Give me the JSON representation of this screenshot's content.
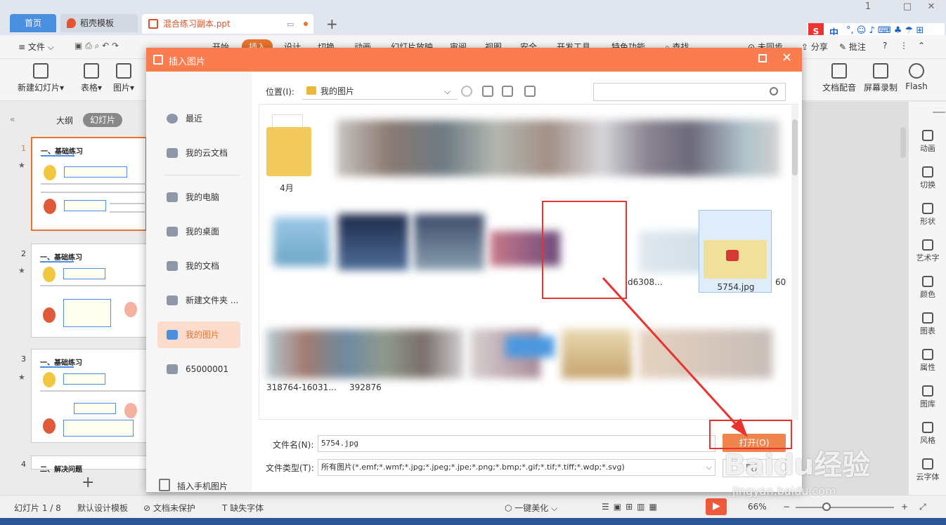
{
  "tabs": {
    "home": "首页",
    "template": "稻壳模板",
    "doc": "混合练习副本.ppt"
  },
  "menu": [
    "文件",
    "开始",
    "插入",
    "设计",
    "切换",
    "动画",
    "幻灯片放映",
    "审阅",
    "视图",
    "安全",
    "开发工具",
    "特色功能",
    "查找"
  ],
  "menu_right": {
    "share": "分享",
    "comment": "批注",
    "sync": "未同步"
  },
  "ribbon": [
    "新建幻灯片",
    "表格",
    "图片"
  ],
  "ribbon_right": [
    "文档配音",
    "屏幕录制",
    "Flash"
  ],
  "sogou": {
    "lang": "中"
  },
  "left_panel": {
    "outline": "大纲",
    "slides": "幻灯片",
    "thumbs": [
      {
        "num": "1",
        "title": "一、基础练习"
      },
      {
        "num": "2",
        "title": "一、基础练习"
      },
      {
        "num": "3",
        "title": "一、基础练习"
      },
      {
        "num": "4",
        "title": "二、解决问题"
      }
    ]
  },
  "right_panel": [
    "动画",
    "切换",
    "形状",
    "艺术字",
    "颜色",
    "图表",
    "属性",
    "图库",
    "风格",
    "云字体"
  ],
  "status": {
    "slide": "幻灯片 1 / 8",
    "design": "默认设计模板",
    "protect": "文档未保护",
    "font": "缺失字体",
    "beautify": "一键美化",
    "zoom": "66%"
  },
  "dialog": {
    "title": "插入图片",
    "nav": [
      "最近",
      "我的云文档",
      "我的电脑",
      "我的桌面",
      "我的文档",
      "新建文件夹 ...",
      "我的图片",
      "65000001"
    ],
    "mobile": "插入手机图片",
    "location_label": "位置(I):",
    "location": "我的图片",
    "files": {
      "folder": "4月",
      "selected": "5754.jpg",
      "partial": [
        "318764-16031...",
        "392876",
        "d6308...",
        "60"
      ]
    },
    "filename_label": "文件名(N):",
    "filename": "5754.jpg",
    "filetype_label": "文件类型(T):",
    "filetype": "所有图片(*.emf;*.wmf;*.jpg;*.jpeg;*.jpe;*.png;*.bmp;*.gif;*.tif;*.tiff;*.wdp;*.svg)",
    "open": "打开(O)",
    "cancel": "取消"
  },
  "watermark": {
    "logo": "Baidu经验",
    "sub": "jingyan.baidu.com"
  },
  "colors": {
    "accent": "#fa7c4f",
    "highlight": "#e8342d"
  }
}
